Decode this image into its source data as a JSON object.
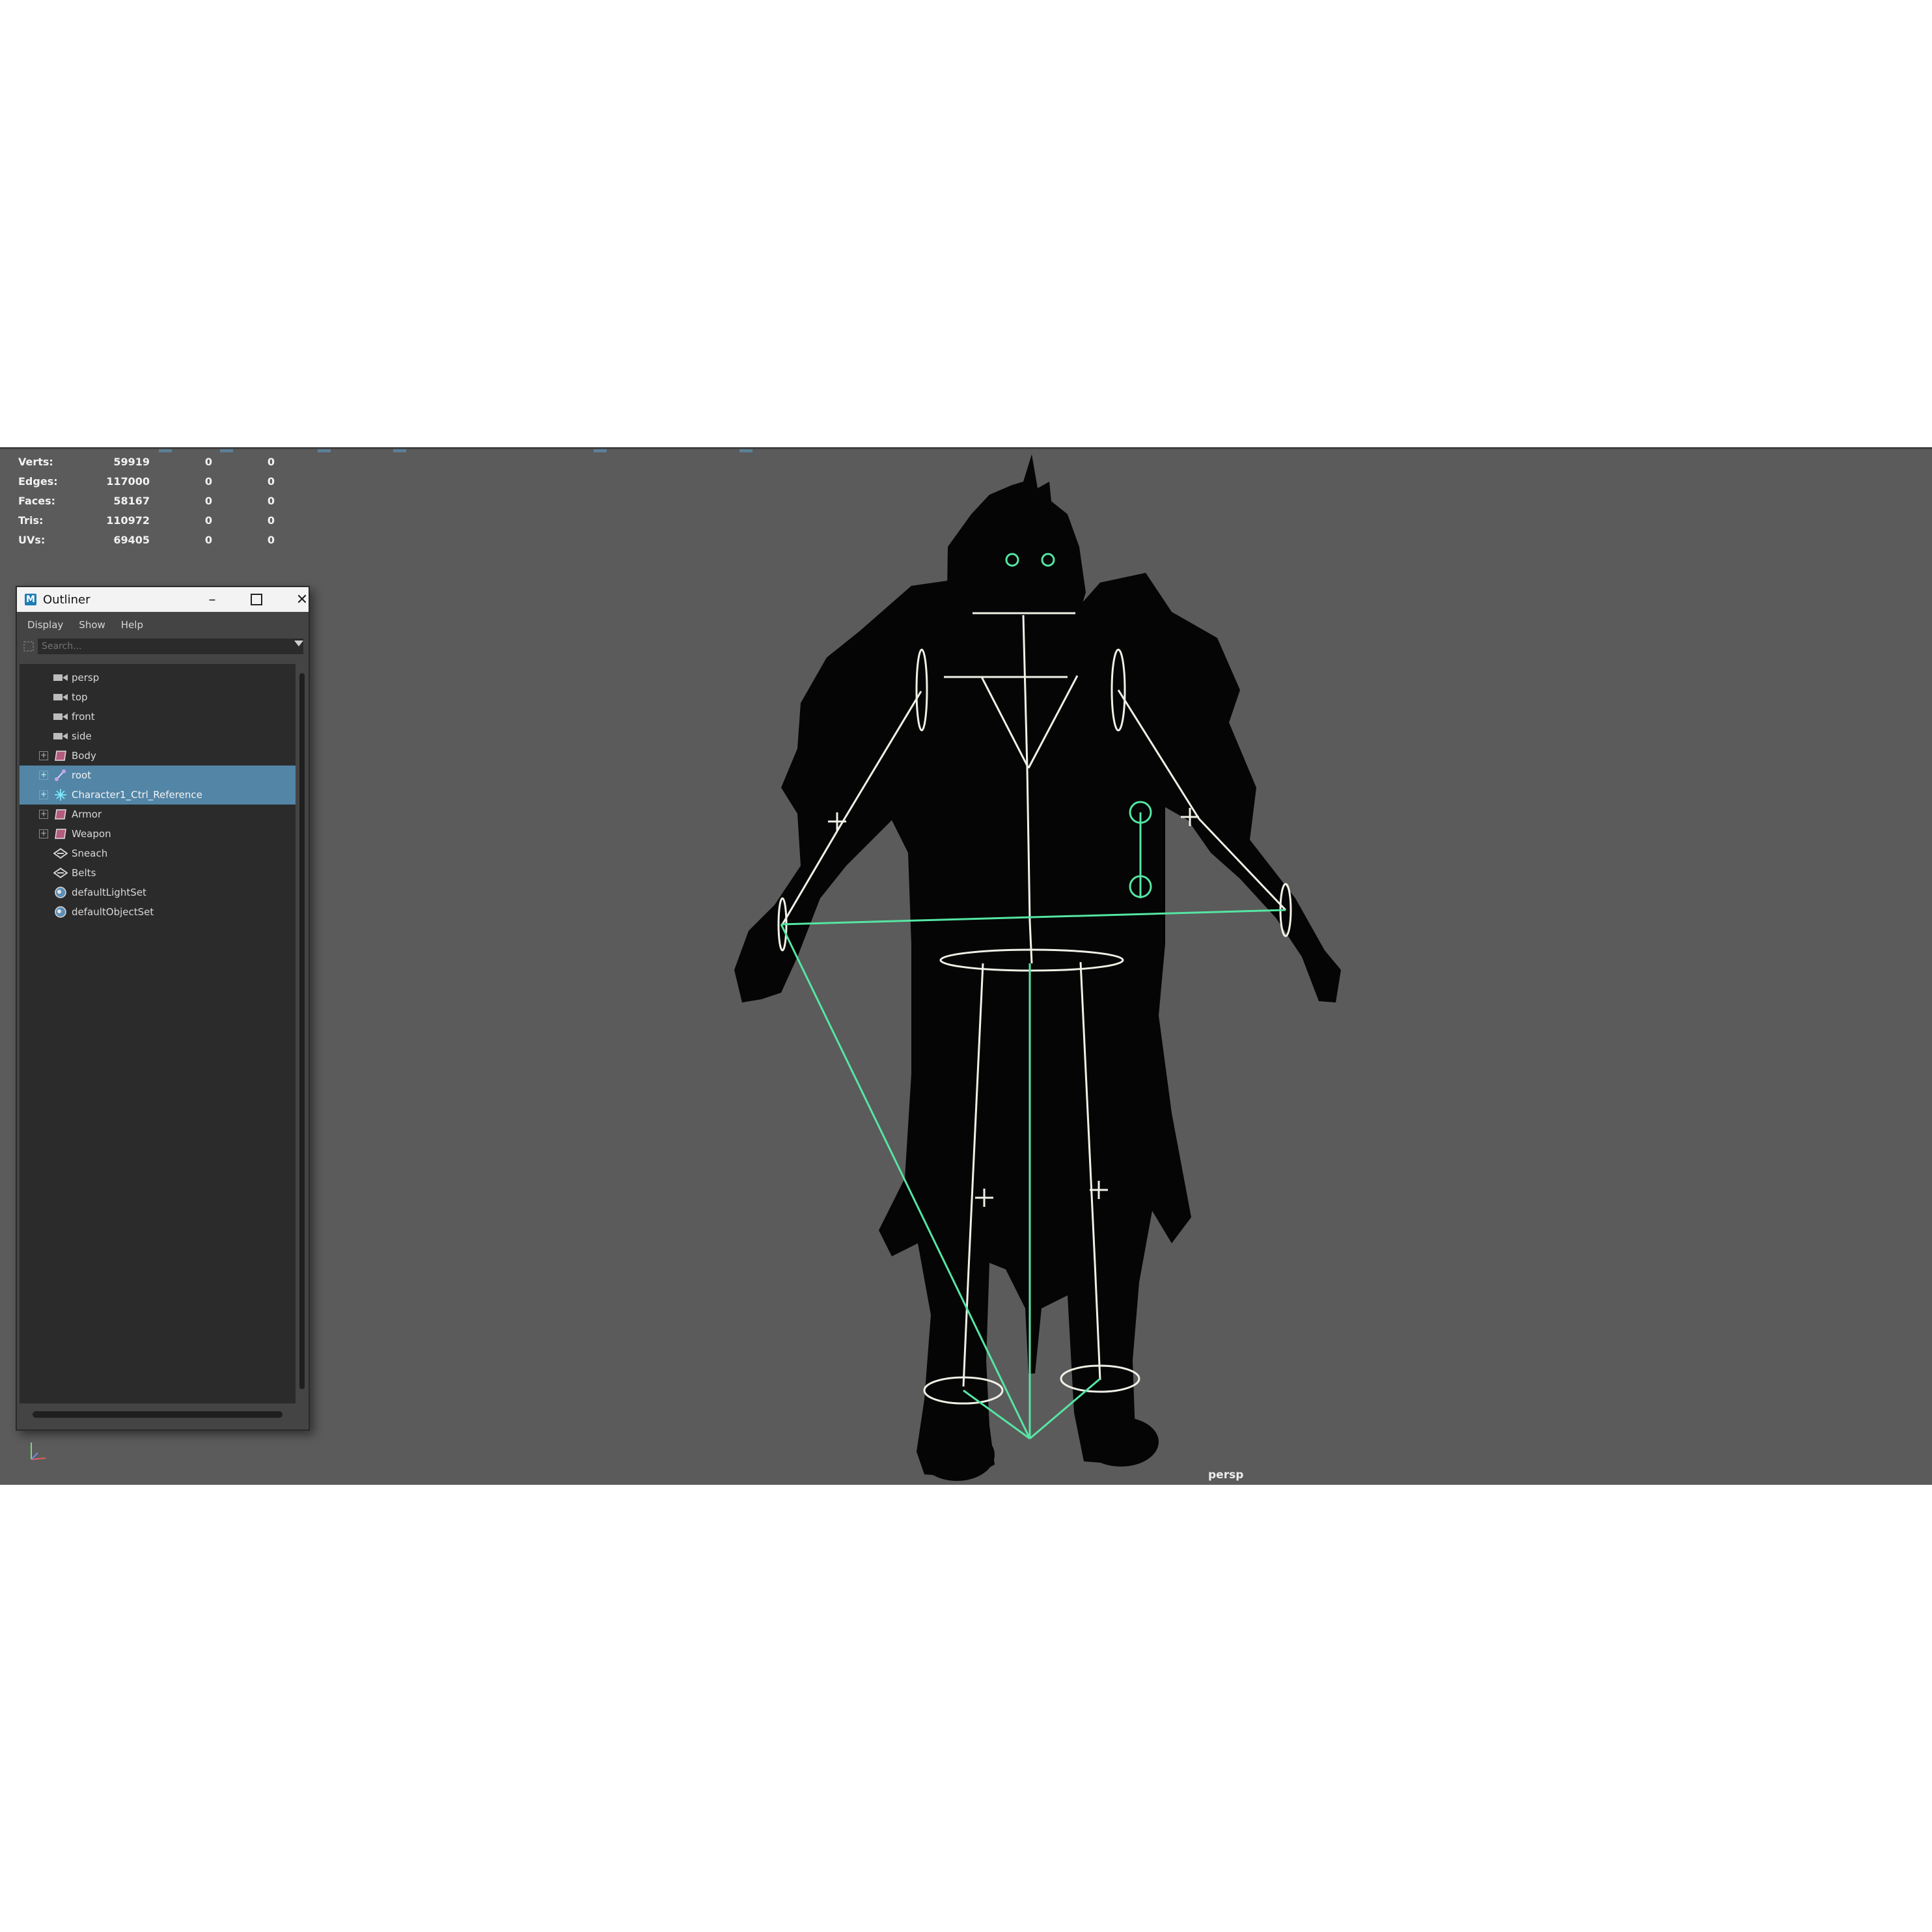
{
  "hud": {
    "rows": [
      {
        "label": "Verts:",
        "value": "59919",
        "c2": "0",
        "c3": "0"
      },
      {
        "label": "Edges:",
        "value": "117000",
        "c2": "0",
        "c3": "0"
      },
      {
        "label": "Faces:",
        "value": "58167",
        "c2": "0",
        "c3": "0"
      },
      {
        "label": "Tris:",
        "value": "110972",
        "c2": "0",
        "c3": "0"
      },
      {
        "label": "UVs:",
        "value": "69405",
        "c2": "0",
        "c3": "0"
      }
    ]
  },
  "viewport": {
    "camera_label": "persp",
    "background_color": "#5b5b5b",
    "skeleton_color": "#f0f0e6",
    "control_color": "#55e6a3"
  },
  "outliner": {
    "title": "Outliner",
    "logo": "M",
    "menu": [
      "Display",
      "Show",
      "Help"
    ],
    "search_placeholder": "Search...",
    "items": [
      {
        "label": "persp",
        "icon": "camera-icon"
      },
      {
        "label": "top",
        "icon": "camera-icon"
      },
      {
        "label": "front",
        "icon": "camera-icon"
      },
      {
        "label": "side",
        "icon": "camera-icon"
      },
      {
        "label": "Body",
        "icon": "mesh-group-icon"
      },
      {
        "label": "root",
        "icon": "joint-icon"
      },
      {
        "label": "Character1_Ctrl_Reference",
        "icon": "hik-control-icon"
      },
      {
        "label": "Armor",
        "icon": "mesh-group-icon"
      },
      {
        "label": "Weapon",
        "icon": "mesh-group-icon"
      },
      {
        "label": "Sneach",
        "icon": "transform-icon"
      },
      {
        "label": "Belts",
        "icon": "transform-icon"
      },
      {
        "label": "defaultLightSet",
        "icon": "set-icon"
      },
      {
        "label": "defaultObjectSet",
        "icon": "set-icon"
      }
    ],
    "selected_color": "#5285a6"
  }
}
